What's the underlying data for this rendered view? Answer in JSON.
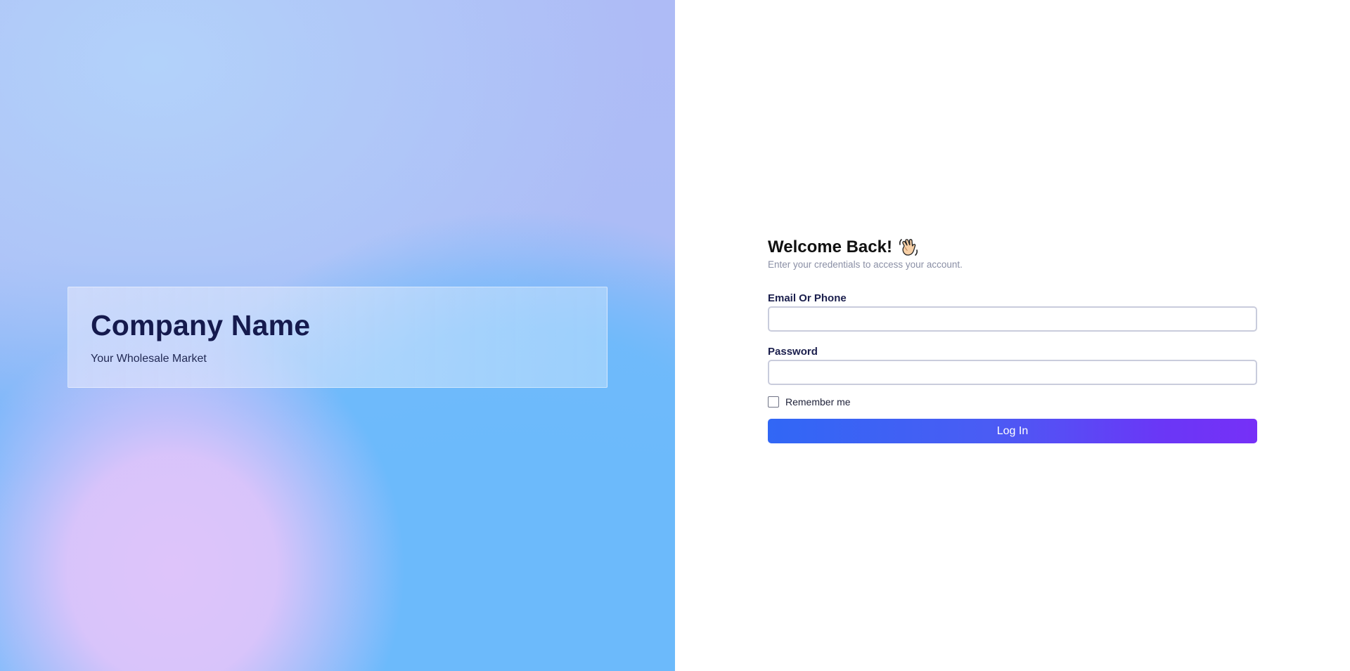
{
  "brand": {
    "company_name": "Company Name",
    "tagline": "Your Wholesale Market"
  },
  "login": {
    "title": "Welcome Back!",
    "title_icon": "waving-hand-icon",
    "subtitle": "Enter your credentials to access your account.",
    "email_label": "Email Or Phone",
    "email_value": "",
    "password_label": "Password",
    "password_value": "",
    "remember_label": "Remember me",
    "remember_checked": false,
    "submit_label": "Log In"
  },
  "colors": {
    "button_gradient_start": "#3167f5",
    "button_gradient_end": "#7630f7",
    "heading_dark": "#151a4d"
  }
}
